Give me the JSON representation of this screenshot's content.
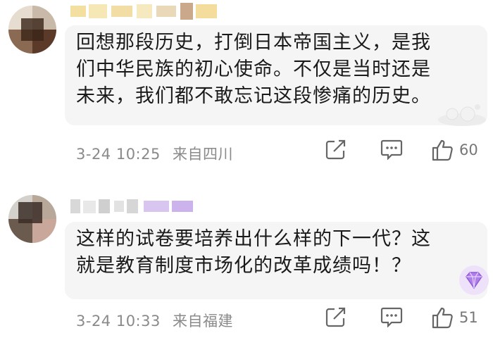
{
  "comments": [
    {
      "text": "回想那段历史，打倒日本帝国主义，是我\n们中华民族的初心使命。不仅是当时还是\n未来，我们都不敢忘记这段惨痛的历史。",
      "timestamp": "3-24 10:25",
      "location": "来自四川",
      "like_count": "60"
    },
    {
      "text": "这样的试卷要培养出什么样的下一代？这\n就是教育制度市场化的改革成绩吗！？",
      "timestamp": "3-24 10:33",
      "location": "来自福建",
      "like_count": "51"
    }
  ],
  "icons": {
    "share": "share-icon",
    "reply": "comment-icon",
    "like": "thumbs-up-icon"
  },
  "colors": {
    "text": "#1a1a1a",
    "meta": "#8a8a8a",
    "bubble": "#f5f5f5",
    "badge": "#b07ee8"
  }
}
